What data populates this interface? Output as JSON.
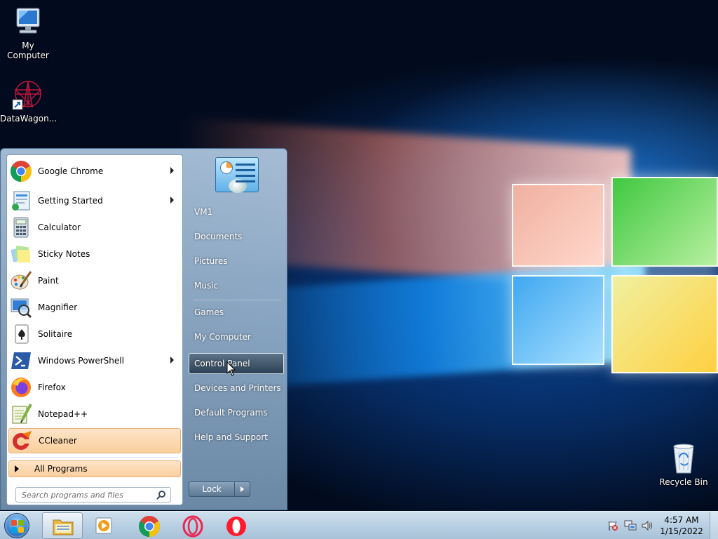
{
  "desktop": {
    "icons": [
      {
        "label": "My Computer"
      },
      {
        "label": "DataWagon..."
      },
      {
        "label": "Recycle Bin"
      }
    ]
  },
  "start_menu": {
    "programs": [
      {
        "label": "Google Chrome",
        "icon": "chrome-icon",
        "has_submenu": true
      },
      {
        "label": "Getting Started",
        "icon": "getting-started-icon",
        "has_submenu": true
      },
      {
        "label": "Calculator",
        "icon": "calculator-icon",
        "has_submenu": false
      },
      {
        "label": "Sticky Notes",
        "icon": "sticky-notes-icon",
        "has_submenu": false
      },
      {
        "label": "Paint",
        "icon": "paint-icon",
        "has_submenu": false
      },
      {
        "label": "Magnifier",
        "icon": "magnifier-icon",
        "has_submenu": false
      },
      {
        "label": "Solitaire",
        "icon": "solitaire-icon",
        "has_submenu": false
      },
      {
        "label": "Windows PowerShell",
        "icon": "powershell-icon",
        "has_submenu": true
      },
      {
        "label": "Firefox",
        "icon": "firefox-icon",
        "has_submenu": false
      },
      {
        "label": "Notepad++",
        "icon": "notepadpp-icon",
        "has_submenu": false
      },
      {
        "label": "CCleaner",
        "icon": "ccleaner-icon",
        "has_submenu": false,
        "highlighted": true
      }
    ],
    "all_programs_label": "All Programs",
    "search_placeholder": "Search programs and files",
    "right_items": [
      {
        "label": "VM1"
      },
      {
        "label": "Documents"
      },
      {
        "label": "Pictures"
      },
      {
        "label": "Music"
      },
      {
        "label": "Games"
      },
      {
        "label": "My Computer"
      },
      {
        "label": "Control Panel",
        "hovered": true
      },
      {
        "label": "Devices and Printers"
      },
      {
        "label": "Default Programs"
      },
      {
        "label": "Help and Support"
      }
    ],
    "lock_label": "Lock"
  },
  "taskbar": {
    "pinned": [
      "explorer-icon",
      "media-player-icon",
      "chrome-icon",
      "opera-gx-icon",
      "opera-icon"
    ],
    "clock_time": "4:57 AM",
    "clock_date": "1/15/2022"
  },
  "colors": {
    "highlight_top": "#fde4c8",
    "highlight_bottom": "#fbcf9d",
    "taskbar": "#b9d0e3"
  }
}
